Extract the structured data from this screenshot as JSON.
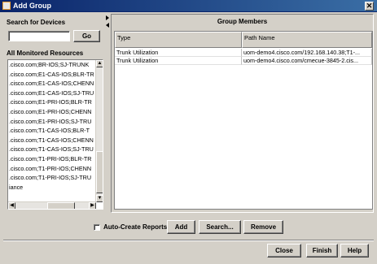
{
  "window": {
    "title": "Add Group",
    "close_glyph": "✕"
  },
  "search": {
    "label": "Search for Devices",
    "value": "",
    "go_label": "Go"
  },
  "resources": {
    "label": "All Monitored Resources",
    "items": [
      ".cisco.com;BR-IOS;SJ-TRUNK",
      ".cisco.com;E1-CAS-IOS;BLR-TR",
      ".cisco.com;E1-CAS-IOS;CHENN",
      ".cisco.com;E1-CAS-IOS;SJ-TRU",
      ".cisco.com;E1-PRI-IOS;BLR-TR",
      ".cisco.com;E1-PRI-IOS;CHENN",
      ".cisco.com;E1-PRI-IOS;SJ-TRU",
      ".cisco.com;T1-CAS-IOS;BLR-T",
      ".cisco.com;T1-CAS-IOS;CHENN",
      ".cisco.com;T1-CAS-IOS;SJ-TRU",
      ".cisco.com;T1-PRI-IOS;BLR-TR",
      ".cisco.com;T1-PRI-IOS;CHENN",
      ".cisco.com;T1-PRI-IOS;SJ-TRU",
      "iance"
    ],
    "scroll_up_icon": "▲",
    "scroll_down_icon": "▼",
    "scroll_left_icon": "◀",
    "scroll_right_icon": "▶"
  },
  "members": {
    "title": "Group Members",
    "columns": [
      "Type",
      "Path Name"
    ],
    "rows": [
      [
        "Trunk Utilization",
        "uom-demo4.cisco.com/192.168.140.38;T1-..."
      ],
      [
        "Trunk Utilization",
        "uom-demo4.cisco.com/cmecue-3845-2.cis..."
      ]
    ]
  },
  "actions": {
    "auto_create_label": "Auto-Create Reports",
    "auto_create_checked": false,
    "add_label": "Add",
    "search_label": "Search...",
    "remove_label": "Remove"
  },
  "footer": {
    "close_label": "Close",
    "finish_label": "Finish",
    "help_label": "Help"
  }
}
